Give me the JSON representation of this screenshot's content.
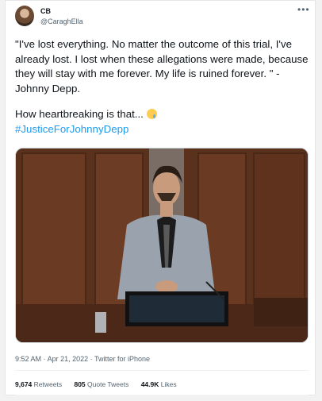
{
  "user": {
    "name": "CB",
    "handle": "@CaraghElla"
  },
  "tweet": {
    "quote": "\"I've lost everything. No matter the outcome of this trial, I've already lost. I lost when these allegations were made, because they will stay with me forever. My life is ruined forever. \" - Johnny Depp.",
    "line2": "How heartbreaking is that...",
    "emoji": "crying-face-icon",
    "hashtag": "#JusticeForJohnnyDepp"
  },
  "meta": {
    "time": "9:52 AM",
    "date": "Apr 21, 2022",
    "source": "Twitter for iPhone",
    "sep": "·"
  },
  "stats": {
    "retweets_count": "9,674",
    "retweets_label": "Retweets",
    "quotes_count": "805",
    "quotes_label": "Quote Tweets",
    "likes_count": "44.9K",
    "likes_label": "Likes"
  },
  "colors": {
    "link": "#1d9bf0",
    "text": "#0f1419",
    "muted": "#536471"
  },
  "icons": {
    "more": "more-options-icon"
  }
}
